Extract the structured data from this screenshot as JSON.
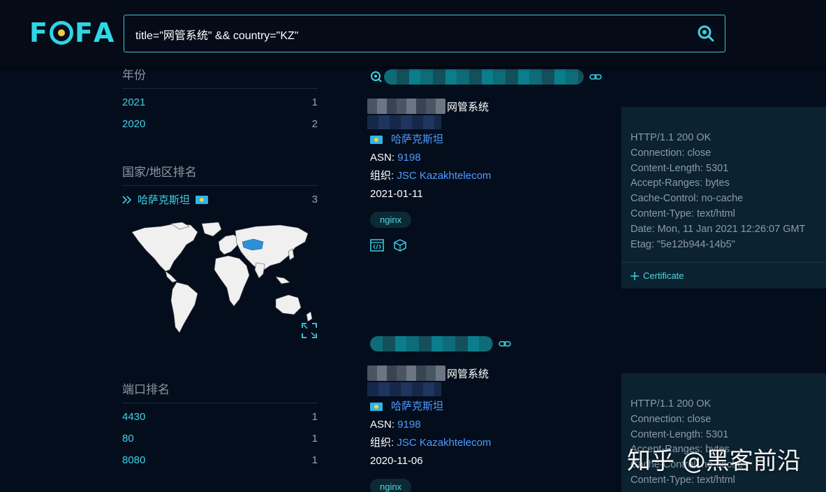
{
  "header": {
    "logo": {
      "f1": "F",
      "f2": "F",
      "a": "A"
    },
    "search": {
      "value": "title=\"网管系统\" && country=\"KZ\""
    }
  },
  "sidebar": {
    "year_section": {
      "title": "年份",
      "rows": [
        {
          "key": "2021",
          "count": "1"
        },
        {
          "key": "2020",
          "count": "2"
        }
      ]
    },
    "country_section": {
      "title": "国家/地区排名",
      "rows": [
        {
          "key": "哈萨克斯坦",
          "count": "3"
        }
      ]
    },
    "port_section": {
      "title": "端口排名",
      "rows": [
        {
          "key": "4430",
          "count": "1"
        },
        {
          "key": "80",
          "count": "1"
        },
        {
          "key": "8080",
          "count": "1"
        }
      ]
    }
  },
  "results": [
    {
      "title": "网管系统",
      "country": "哈萨克斯坦",
      "asn_label": "ASN:",
      "asn": "9198",
      "org_label": "组织:",
      "org": "JSC Kazakhtelecom",
      "date": "2021-01-11",
      "tag": "nginx",
      "banner": [
        "HTTP/1.1 200 OK",
        "Connection: close",
        "Content-Length: 5301",
        "Accept-Ranges: bytes",
        "Cache-Control: no-cache",
        "Content-Type: text/html",
        "Date: Mon, 11 Jan 2021 12:26:07 GMT",
        "Etag: \"5e12b944-14b5\""
      ],
      "certificate": "Certificate"
    },
    {
      "title": "网管系统",
      "country": "哈萨克斯坦",
      "asn_label": "ASN:",
      "asn": "9198",
      "org_label": "组织:",
      "org": "JSC Kazakhtelecom",
      "date": "2020-11-06",
      "tag": "nginx",
      "banner": [
        "HTTP/1.1 200 OK",
        "Connection: close",
        "Content-Length: 5301",
        "Accept-Ranges: bytes",
        "Cache-Control: no-cache",
        "Content-Type: text/html"
      ]
    }
  ],
  "watermark": "知乎 @黑客前沿",
  "colors": {
    "accent": "#3fd2e6",
    "link": "#4f9bff",
    "background": "#040d1c",
    "banner": "#0b2230"
  }
}
